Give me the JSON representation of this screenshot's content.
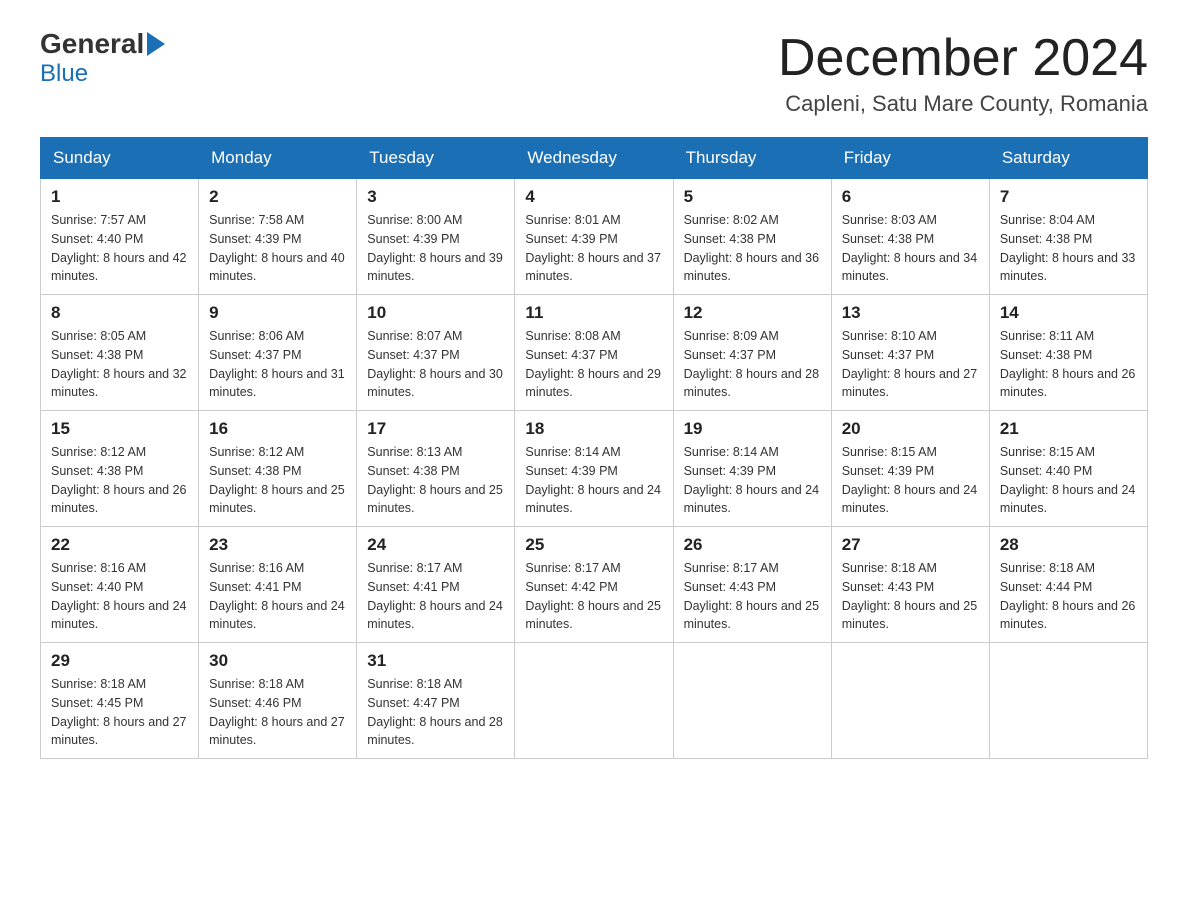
{
  "header": {
    "logo_general": "General",
    "logo_blue": "Blue",
    "month_title": "December 2024",
    "location": "Capleni, Satu Mare County, Romania"
  },
  "weekdays": [
    "Sunday",
    "Monday",
    "Tuesday",
    "Wednesday",
    "Thursday",
    "Friday",
    "Saturday"
  ],
  "weeks": [
    [
      {
        "day": 1,
        "sunrise": "7:57 AM",
        "sunset": "4:40 PM",
        "daylight": "8 hours and 42 minutes."
      },
      {
        "day": 2,
        "sunrise": "7:58 AM",
        "sunset": "4:39 PM",
        "daylight": "8 hours and 40 minutes."
      },
      {
        "day": 3,
        "sunrise": "8:00 AM",
        "sunset": "4:39 PM",
        "daylight": "8 hours and 39 minutes."
      },
      {
        "day": 4,
        "sunrise": "8:01 AM",
        "sunset": "4:39 PM",
        "daylight": "8 hours and 37 minutes."
      },
      {
        "day": 5,
        "sunrise": "8:02 AM",
        "sunset": "4:38 PM",
        "daylight": "8 hours and 36 minutes."
      },
      {
        "day": 6,
        "sunrise": "8:03 AM",
        "sunset": "4:38 PM",
        "daylight": "8 hours and 34 minutes."
      },
      {
        "day": 7,
        "sunrise": "8:04 AM",
        "sunset": "4:38 PM",
        "daylight": "8 hours and 33 minutes."
      }
    ],
    [
      {
        "day": 8,
        "sunrise": "8:05 AM",
        "sunset": "4:38 PM",
        "daylight": "8 hours and 32 minutes."
      },
      {
        "day": 9,
        "sunrise": "8:06 AM",
        "sunset": "4:37 PM",
        "daylight": "8 hours and 31 minutes."
      },
      {
        "day": 10,
        "sunrise": "8:07 AM",
        "sunset": "4:37 PM",
        "daylight": "8 hours and 30 minutes."
      },
      {
        "day": 11,
        "sunrise": "8:08 AM",
        "sunset": "4:37 PM",
        "daylight": "8 hours and 29 minutes."
      },
      {
        "day": 12,
        "sunrise": "8:09 AM",
        "sunset": "4:37 PM",
        "daylight": "8 hours and 28 minutes."
      },
      {
        "day": 13,
        "sunrise": "8:10 AM",
        "sunset": "4:37 PM",
        "daylight": "8 hours and 27 minutes."
      },
      {
        "day": 14,
        "sunrise": "8:11 AM",
        "sunset": "4:38 PM",
        "daylight": "8 hours and 26 minutes."
      }
    ],
    [
      {
        "day": 15,
        "sunrise": "8:12 AM",
        "sunset": "4:38 PM",
        "daylight": "8 hours and 26 minutes."
      },
      {
        "day": 16,
        "sunrise": "8:12 AM",
        "sunset": "4:38 PM",
        "daylight": "8 hours and 25 minutes."
      },
      {
        "day": 17,
        "sunrise": "8:13 AM",
        "sunset": "4:38 PM",
        "daylight": "8 hours and 25 minutes."
      },
      {
        "day": 18,
        "sunrise": "8:14 AM",
        "sunset": "4:39 PM",
        "daylight": "8 hours and 24 minutes."
      },
      {
        "day": 19,
        "sunrise": "8:14 AM",
        "sunset": "4:39 PM",
        "daylight": "8 hours and 24 minutes."
      },
      {
        "day": 20,
        "sunrise": "8:15 AM",
        "sunset": "4:39 PM",
        "daylight": "8 hours and 24 minutes."
      },
      {
        "day": 21,
        "sunrise": "8:15 AM",
        "sunset": "4:40 PM",
        "daylight": "8 hours and 24 minutes."
      }
    ],
    [
      {
        "day": 22,
        "sunrise": "8:16 AM",
        "sunset": "4:40 PM",
        "daylight": "8 hours and 24 minutes."
      },
      {
        "day": 23,
        "sunrise": "8:16 AM",
        "sunset": "4:41 PM",
        "daylight": "8 hours and 24 minutes."
      },
      {
        "day": 24,
        "sunrise": "8:17 AM",
        "sunset": "4:41 PM",
        "daylight": "8 hours and 24 minutes."
      },
      {
        "day": 25,
        "sunrise": "8:17 AM",
        "sunset": "4:42 PM",
        "daylight": "8 hours and 25 minutes."
      },
      {
        "day": 26,
        "sunrise": "8:17 AM",
        "sunset": "4:43 PM",
        "daylight": "8 hours and 25 minutes."
      },
      {
        "day": 27,
        "sunrise": "8:18 AM",
        "sunset": "4:43 PM",
        "daylight": "8 hours and 25 minutes."
      },
      {
        "day": 28,
        "sunrise": "8:18 AM",
        "sunset": "4:44 PM",
        "daylight": "8 hours and 26 minutes."
      }
    ],
    [
      {
        "day": 29,
        "sunrise": "8:18 AM",
        "sunset": "4:45 PM",
        "daylight": "8 hours and 27 minutes."
      },
      {
        "day": 30,
        "sunrise": "8:18 AM",
        "sunset": "4:46 PM",
        "daylight": "8 hours and 27 minutes."
      },
      {
        "day": 31,
        "sunrise": "8:18 AM",
        "sunset": "4:47 PM",
        "daylight": "8 hours and 28 minutes."
      },
      null,
      null,
      null,
      null
    ]
  ]
}
